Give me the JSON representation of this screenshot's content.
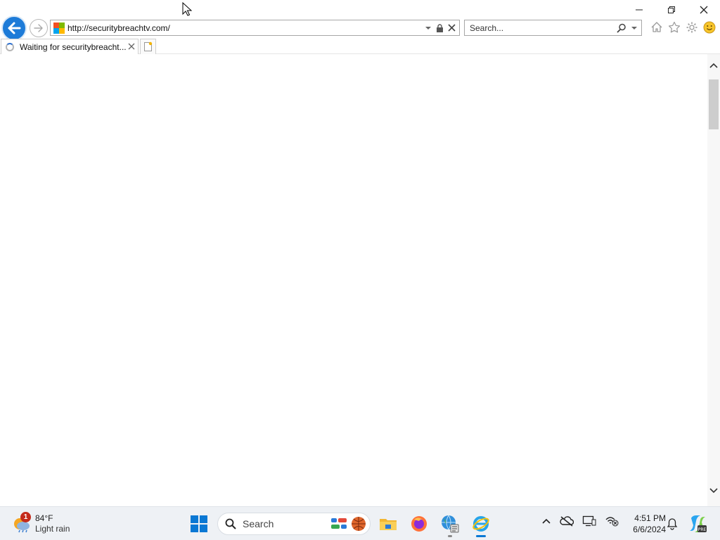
{
  "browser": {
    "address_url": "http://securitybreachtv.com/",
    "search_placeholder": "Search...",
    "tabs": [
      {
        "title": "Waiting for securitybreacht..."
      }
    ]
  },
  "window_controls": {
    "minimize": "—",
    "restore": "❐",
    "close": "✕"
  },
  "taskbar": {
    "weather": {
      "temp": "84°F",
      "desc": "Light rain",
      "badge": "1"
    },
    "search_label": "Search",
    "clock": {
      "time": "4:51 PM",
      "date": "6/6/2024"
    },
    "apps": [
      "start",
      "widgets",
      "file-explorer",
      "firefox",
      "network-settings",
      "internet-explorer"
    ]
  },
  "colors": {
    "accent": "#1d7bd8",
    "taskbar_bg": "#eef1f5",
    "start_blue": "#0a78d4",
    "weather_badge": "#c42b1c"
  }
}
